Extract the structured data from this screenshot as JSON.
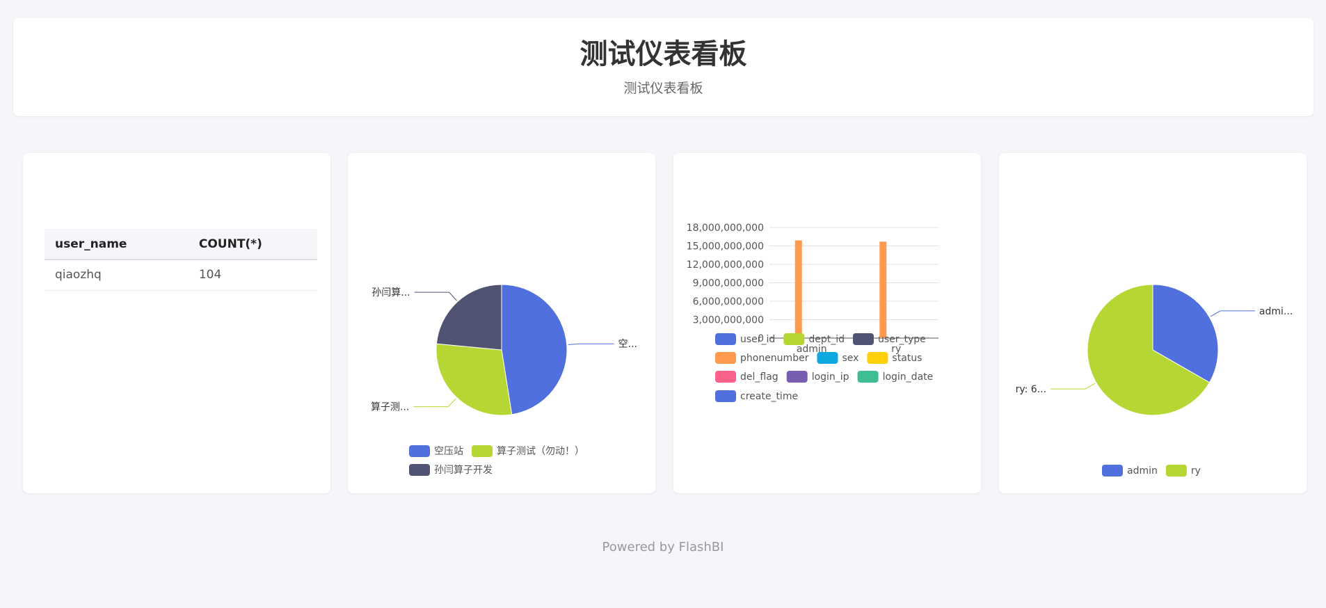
{
  "header": {
    "title": "测试仪表看板",
    "subtitle": "测试仪表看板"
  },
  "table": {
    "columns": [
      "user_name",
      "COUNT(*)"
    ],
    "rows": [
      [
        "qiaozhq",
        "104"
      ]
    ]
  },
  "chart_data": [
    {
      "type": "table",
      "columns": [
        "user_name",
        "COUNT(*)"
      ],
      "rows": [
        [
          "qiaozhq",
          104
        ]
      ]
    },
    {
      "type": "pie",
      "slices": [
        {
          "name": "空压站",
          "value": 47.5,
          "label": "空...",
          "color": "#5070dd"
        },
        {
          "name": "算子测试（勿动！）",
          "value": 29,
          "label": "算子测...",
          "color": "#b6d634"
        },
        {
          "name": "孙闫算子开发",
          "value": 23.5,
          "label": "孙闫算...",
          "color": "#505372"
        }
      ],
      "legend": "bottom"
    },
    {
      "type": "bar",
      "categories": [
        "admin",
        "ry"
      ],
      "series": [
        {
          "name": "user_id",
          "values": [
            0,
            0
          ],
          "color": "#5070dd"
        },
        {
          "name": "dept_id",
          "values": [
            0,
            0
          ],
          "color": "#b6d634"
        },
        {
          "name": "user_type",
          "values": [
            0,
            0
          ],
          "color": "#505372"
        },
        {
          "name": "phonenumber",
          "values": [
            15900000000,
            15700000000
          ],
          "color": "#ff994d"
        },
        {
          "name": "sex",
          "values": [
            0,
            0
          ],
          "color": "#0ca8df"
        },
        {
          "name": "status",
          "values": [
            0,
            0
          ],
          "color": "#ffd10a"
        },
        {
          "name": "del_flag",
          "values": [
            0,
            0
          ],
          "color": "#fb628b"
        },
        {
          "name": "login_ip",
          "values": [
            0,
            0
          ],
          "color": "#785db0"
        },
        {
          "name": "login_date",
          "values": [
            0,
            0
          ],
          "color": "#3fbe95"
        },
        {
          "name": "create_time",
          "values": [
            0,
            0
          ],
          "color": "#5070dd"
        }
      ],
      "yticks": [
        "0",
        "3,000,000,000",
        "6,000,000,000",
        "9,000,000,000",
        "12,000,000,000",
        "15,000,000,000",
        "18,000,000,000"
      ],
      "ylim": [
        0,
        18000000000
      ],
      "grid": true,
      "legend": "bottom"
    },
    {
      "type": "pie",
      "slices": [
        {
          "name": "admin",
          "value": 33.3,
          "label": "admi...",
          "color": "#5070dd"
        },
        {
          "name": "ry",
          "value": 66.7,
          "label": "ry: 6...",
          "color": "#b6d634"
        }
      ],
      "legend": "bottom"
    }
  ],
  "footer": "Powered by FlashBI"
}
